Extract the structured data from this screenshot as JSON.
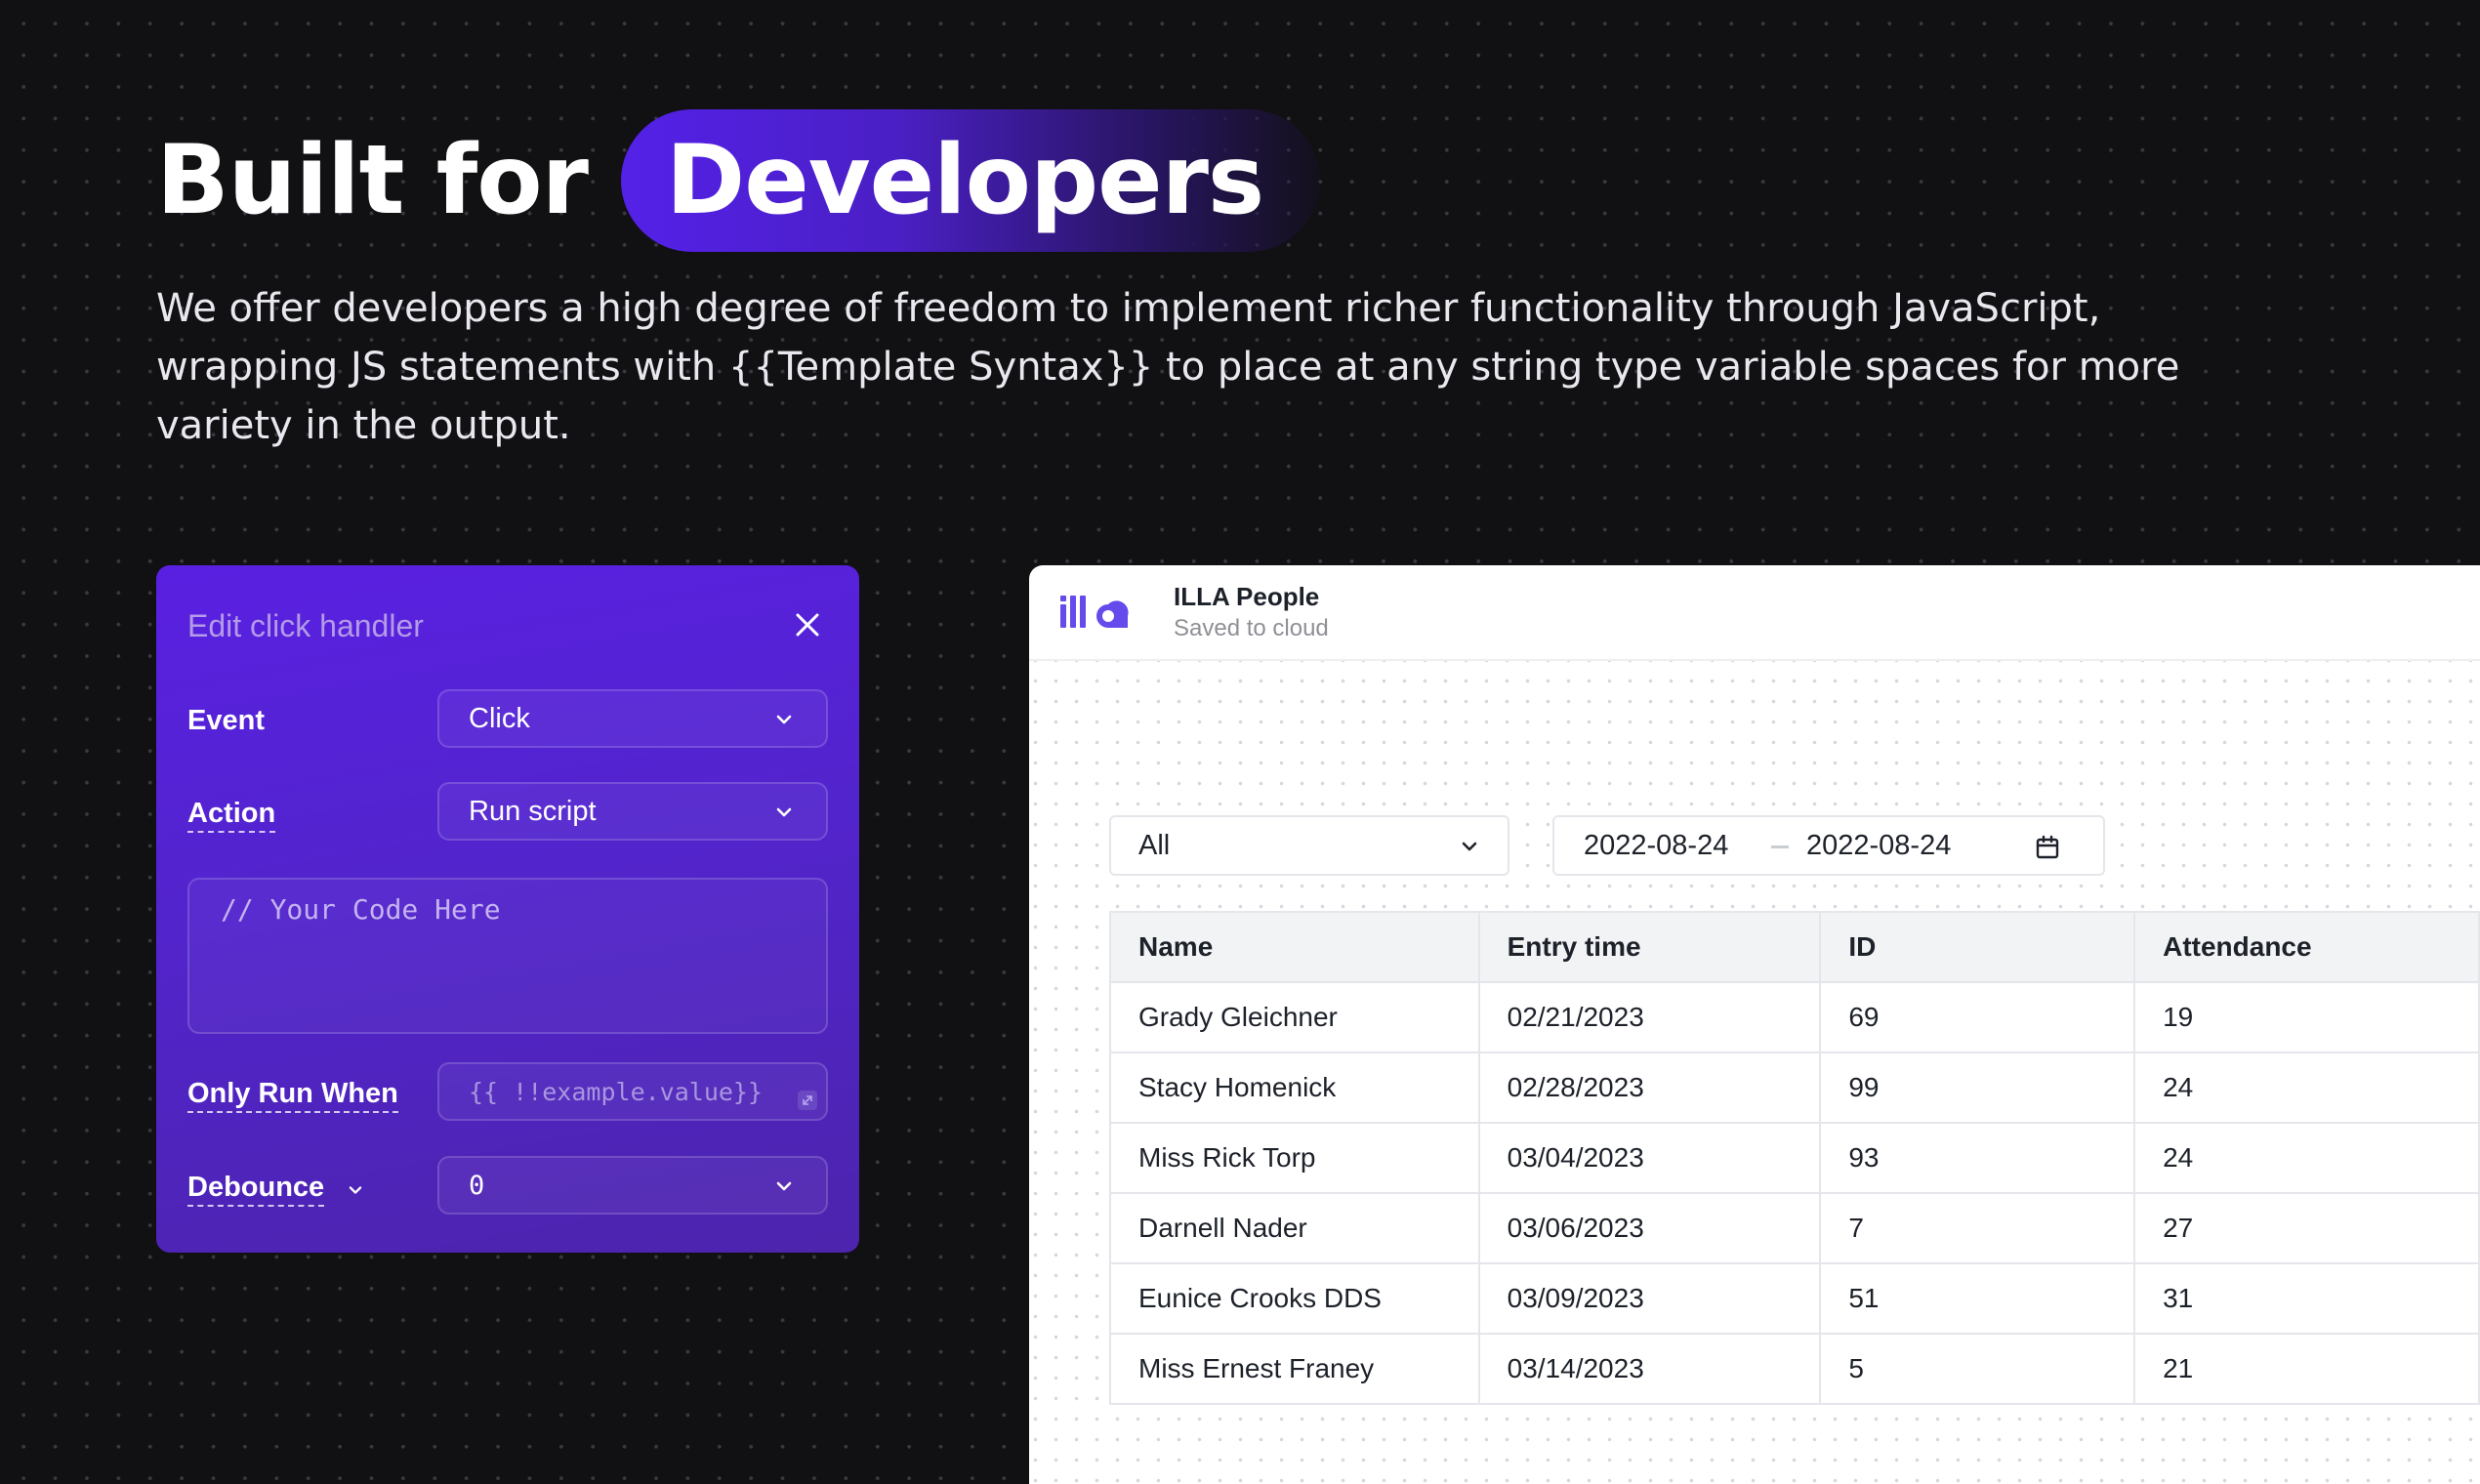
{
  "hero": {
    "title_prefix": "Built for",
    "title_highlight": "Developers",
    "description": "We offer developers a high degree of freedom to implement richer functionality through JavaScript, wrapping JS statements with {{Template Syntax}} to place at any string type variable spaces for more variety in the output."
  },
  "handler_panel": {
    "title": "Edit click handler",
    "event": {
      "label": "Event",
      "value": "Click"
    },
    "action": {
      "label": "Action",
      "value": "Run script"
    },
    "code_placeholder": "// Your Code Here",
    "only_run_when": {
      "label": "Only Run When",
      "placeholder": "{{ !!example.value}}"
    },
    "debounce": {
      "label": "Debounce",
      "value": "0"
    },
    "colors": {
      "panel_top": "#5a20e2",
      "panel_bottom": "#4c24ad"
    }
  },
  "app": {
    "logo_text": "illa",
    "name": "ILLA People",
    "status": "Saved to cloud",
    "filter": {
      "value": "All"
    },
    "date_range": {
      "start": "2022-08-24",
      "end": "2022-08-24"
    },
    "table": {
      "columns": [
        "Name",
        "Entry time",
        "ID",
        "Attendance"
      ],
      "rows": [
        [
          "Grady Gleichner",
          "02/21/2023",
          "69",
          "19"
        ],
        [
          "Stacy Homenick",
          "02/28/2023",
          "99",
          "24"
        ],
        [
          "Miss Rick Torp",
          "03/04/2023",
          "93",
          "24"
        ],
        [
          "Darnell Nader",
          "03/06/2023",
          "7",
          "27"
        ],
        [
          "Eunice Crooks DDS",
          "03/09/2023",
          "51",
          "31"
        ],
        [
          "Miss Ernest Franey",
          "03/14/2023",
          "5",
          "21"
        ]
      ]
    },
    "colors": {
      "brand": "#654aec"
    }
  }
}
